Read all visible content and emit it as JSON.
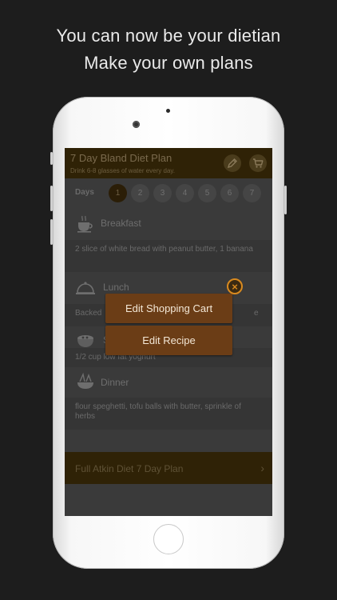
{
  "headline": {
    "line1": "You can now be your dietian",
    "line2": "Make your own plans"
  },
  "app": {
    "title": "7 Day Bland Diet Plan",
    "subtitle": "Drink 6-8 glasses of water every day.",
    "edit_icon": "pencil-icon",
    "cart_icon": "cart-icon"
  },
  "days": {
    "label": "Days",
    "items": [
      "1",
      "2",
      "3",
      "4",
      "5",
      "6",
      "7"
    ],
    "selected": "1"
  },
  "meals": [
    {
      "name": "Breakfast",
      "icon": "coffee-cup-icon",
      "description": "2 slice of white bread with peanut butter, 1 banana"
    },
    {
      "name": "Lunch",
      "icon": "cloche-icon",
      "description": "Backed"
    },
    {
      "name": "S",
      "icon": "snack-bowl-icon",
      "description": "1/2 cup low fat yoghurt"
    },
    {
      "name": "Dinner",
      "icon": "dinner-plate-icon",
      "description": "flour speghetti, tofu balls with butter, sprinkle of herbs"
    }
  ],
  "lunch_desc_tail": "e",
  "plan_link": {
    "label": "Full Atkin Diet 7 Day Plan",
    "chevron": "›"
  },
  "popup": {
    "option1": "Edit Shopping Cart",
    "option2": "Edit Recipe",
    "close": "×"
  },
  "colors": {
    "accent": "#d98a1f",
    "popup_button": "#6b3d16",
    "top_bar": "#2f2206",
    "background": "#1d1d1d"
  }
}
